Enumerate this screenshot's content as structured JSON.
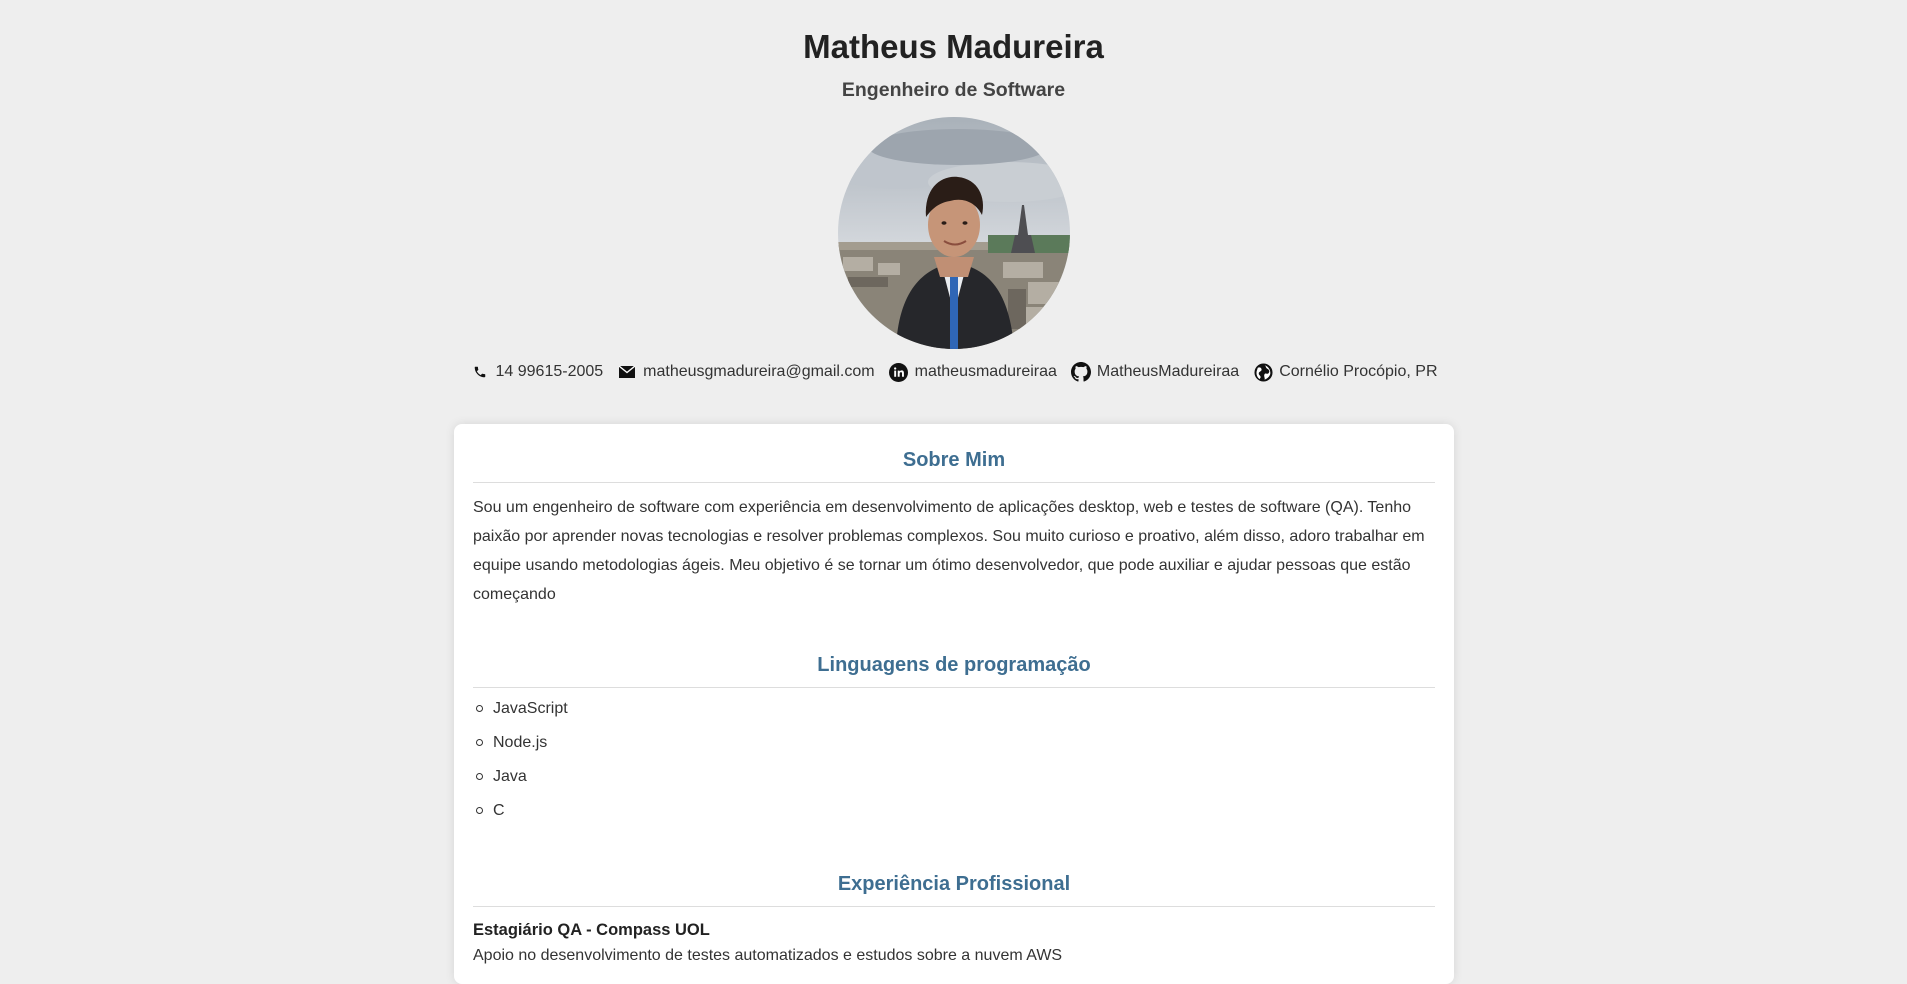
{
  "profile": {
    "name": "Matheus Madureira",
    "role": "Engenheiro de Software"
  },
  "contacts": {
    "phone": "14 99615-2005",
    "email": "matheusgmadureira@gmail.com",
    "linkedin": "matheusmadureiraa",
    "github": "MatheusMadureiraa",
    "location": "Cornélio Procópio, PR"
  },
  "icons": {
    "phone": "phone-icon",
    "email": "envelope-icon",
    "linkedin": "linkedin-icon",
    "github": "github-icon",
    "location": "globe-icon"
  },
  "about": {
    "title": "Sobre Mim",
    "text": "Sou um engenheiro de software com experiência em desenvolvimento de aplicações desktop, web e testes de software (QA). Tenho paixão por aprender novas tecnologias e resolver problemas complexos. Sou muito curioso e proativo, além disso, adoro trabalhar em equipe usando metodologias ágeis. Meu objetivo é se tornar um ótimo desenvolvedor, que pode auxiliar e ajudar pessoas que estão começando"
  },
  "languages": {
    "title": "Linguagens de programação",
    "items": [
      "JavaScript",
      "Node.js",
      "Java",
      "C"
    ]
  },
  "experience": {
    "title": "Experiência Profissional",
    "jobs": [
      {
        "title": "Estagiário QA - Compass UOL",
        "description": "Apoio no desenvolvimento de testes automatizados e estudos sobre a nuvem AWS"
      }
    ]
  },
  "colors": {
    "background": "#eeeeee",
    "accent": "#3e6e91",
    "text": "#333333"
  }
}
